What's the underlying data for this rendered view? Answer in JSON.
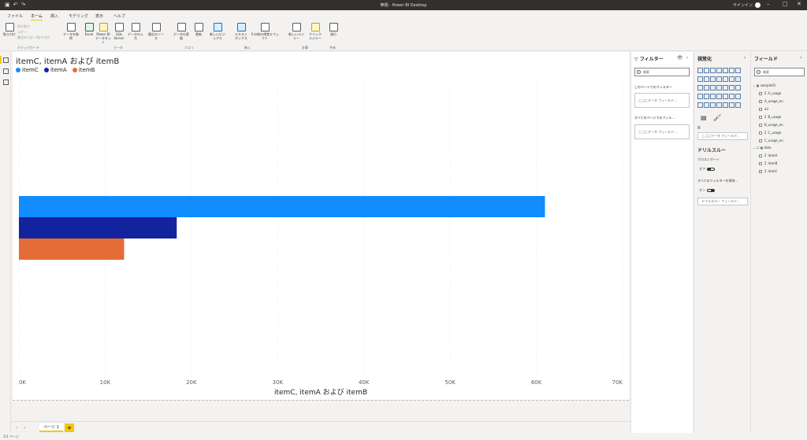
{
  "window": {
    "title": "無題 - Power BI Desktop",
    "signin": "サインイン"
  },
  "tabs": [
    "ファイル",
    "ホーム",
    "挿入",
    "モデリング",
    "表示",
    "ヘルプ"
  ],
  "ribbon": {
    "clipboard": {
      "paste": "貼り付け",
      "cut": "切り取り",
      "copy": "コピー",
      "format_painter": "書式のコピー/貼り付け",
      "group": "クリップボード"
    },
    "data_buttons": [
      "データを取得",
      "Excel",
      "Power BI データセット",
      "SQL Server",
      "データの入力",
      "最近のソース"
    ],
    "data_group": "データ",
    "query_buttons": [
      "データの変換",
      "更新"
    ],
    "query_group": "クエリ",
    "insert_buttons": [
      "新しいビジュアル",
      "テキスト ボックス",
      "その他の視覚エフェクト"
    ],
    "insert_group": "挿入",
    "calc_buttons": [
      "新しいメジャー",
      "クイック メジャー"
    ],
    "calc_group": "計算",
    "share_buttons": [
      "発行"
    ],
    "share_group": "共有"
  },
  "visual": {
    "title": "itemC, itemA および itemB",
    "legend": [
      {
        "label": "itemC",
        "color": "#118dff"
      },
      {
        "label": "itemA",
        "color": "#12239e"
      },
      {
        "label": "itemB",
        "color": "#e66c37"
      }
    ]
  },
  "chart_data": {
    "type": "bar",
    "orientation": "horizontal",
    "title": "itemC, itemA および itemB",
    "xlabel": "itemC, itemA および itemB",
    "ylabel": "",
    "series": [
      {
        "name": "itemC",
        "value": 61000,
        "color": "#118dff"
      },
      {
        "name": "itemA",
        "value": 18300,
        "color": "#12239e"
      },
      {
        "name": "itemB",
        "value": 12200,
        "color": "#e66c37"
      }
    ],
    "xlim": [
      0,
      70000
    ],
    "xticks": [
      "0K",
      "10K",
      "20K",
      "30K",
      "40K",
      "50K",
      "60K",
      "70K"
    ],
    "grid": true,
    "legend_position": "top-left"
  },
  "filters": {
    "title": "フィルター",
    "search_placeholder": "検索",
    "page_label": "このページでのフィルター",
    "page_drop": "ここにデータ フィールド...",
    "all_label": "すべてのページでのフィル...",
    "all_drop": "ここにデータ フィールド..."
  },
  "viz_pane": {
    "title": "視覚化",
    "values_drop": "ここにデータ フィールド...",
    "drill_title": "ドリルスルー",
    "cross_report": "クロスレポート",
    "off": "オフ",
    "keep_filters": "すべてのフィルターを保持...",
    "on": "オン",
    "drill_drop": "ドリルスルー フィールド..."
  },
  "fields_pane": {
    "title": "フィールド",
    "search_placeholder": "検索",
    "table1": "sample01",
    "fields1": [
      "A_usage",
      "A_usage_en",
      "all",
      "B_usage",
      "B_usage_en",
      "C_usage",
      "C_usage_en"
    ],
    "table2": "date",
    "fields2": [
      "itemA",
      "itemB",
      "itemC"
    ]
  },
  "pages": {
    "tab": "ページ 1",
    "add": "+"
  },
  "status": "1/1 ページ"
}
